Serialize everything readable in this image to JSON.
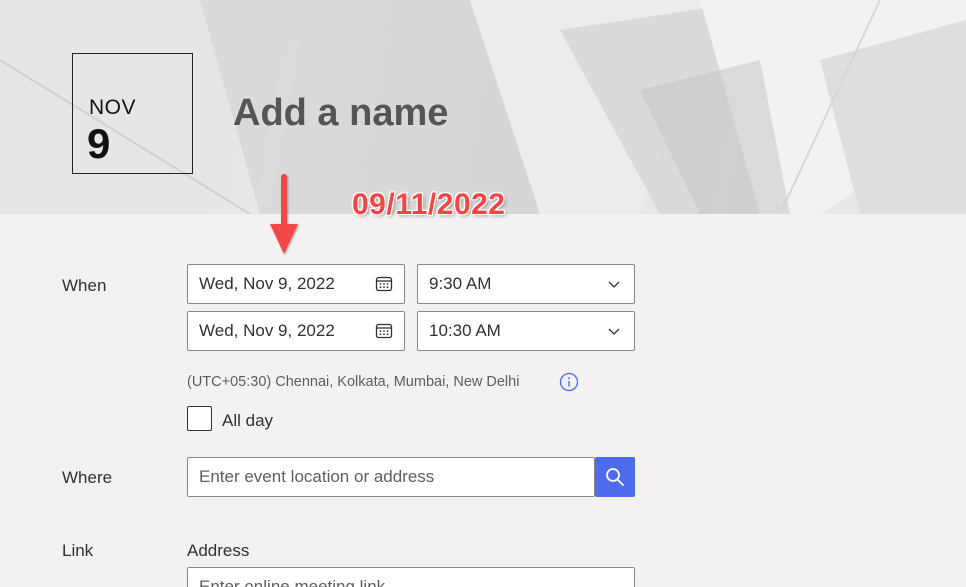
{
  "header": {
    "month": "NOV",
    "day": "9",
    "title": "Add a name"
  },
  "annotation": {
    "text": "09/11/2022",
    "color": "#f04646"
  },
  "when": {
    "label": "When",
    "start_date": "Wed, Nov 9, 2022",
    "start_time": "9:30 AM",
    "end_date": "Wed, Nov 9, 2022",
    "end_time": "10:30 AM",
    "timezone": "(UTC+05:30) Chennai, Kolkata, Mumbai, New Delhi",
    "all_day_label": "All day",
    "all_day_checked": false,
    "icons": {
      "date": "calendar-icon",
      "time": "chevron-down-icon",
      "info": "info-icon"
    }
  },
  "where": {
    "label": "Where",
    "placeholder": "Enter event location or address",
    "search_icon": "search-icon",
    "accent": "#4f6bed"
  },
  "link": {
    "label": "Link",
    "address_label": "Address",
    "placeholder": "Enter online meeting link"
  }
}
